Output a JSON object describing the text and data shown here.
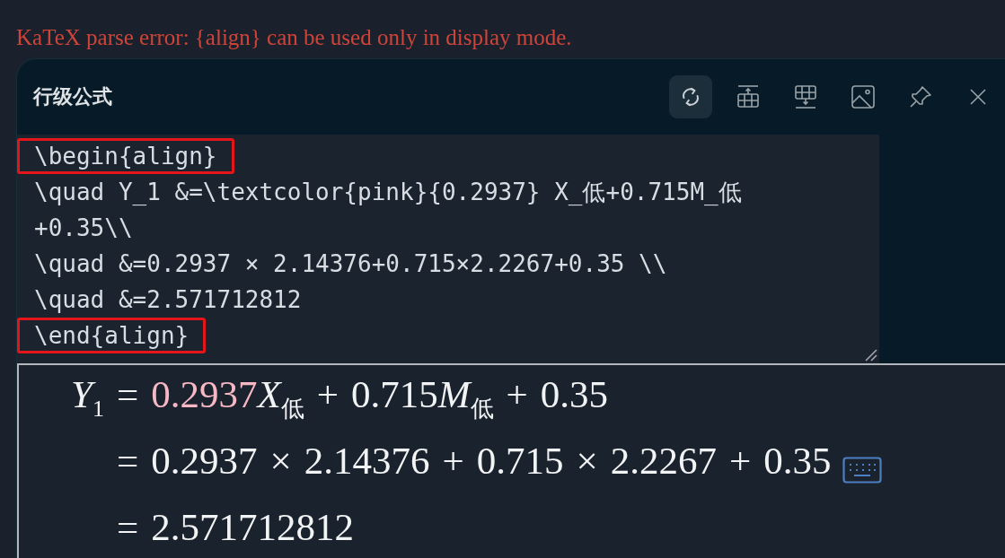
{
  "error_message": "KaTeX parse error: {align} can be used only in display mode.",
  "panel": {
    "title": "行级公式",
    "toolbar": [
      {
        "kind": "refresh",
        "selected": true
      },
      {
        "kind": "insert-above",
        "selected": false
      },
      {
        "kind": "insert-below",
        "selected": false
      },
      {
        "kind": "image",
        "selected": false
      },
      {
        "kind": "pin",
        "selected": false
      },
      {
        "kind": "close",
        "selected": false
      }
    ]
  },
  "editor": {
    "lines": [
      {
        "text": "\\begin{align}",
        "highlighted": true
      },
      {
        "text": "\\quad Y_1 &=\\textcolor{pink}{0.2937} X_低+0.715M_低",
        "highlighted": false
      },
      {
        "text": "+0.35\\\\",
        "highlighted": false
      },
      {
        "text": "\\quad &=0.2937 × 2.14376+0.715×2.2267+0.35 \\\\",
        "highlighted": false
      },
      {
        "text": "\\quad &=2.571712812",
        "highlighted": false
      },
      {
        "text": "\\end{align}",
        "highlighted": true
      }
    ]
  },
  "preview": {
    "rows": [
      {
        "left": [
          {
            "text": "Y",
            "kind": "italic",
            "sub": "1"
          }
        ],
        "right": [
          {
            "text": "=",
            "kind": "operator"
          },
          {
            "text": "0.2937",
            "kind": "pink"
          },
          {
            "text": "X",
            "kind": "italic",
            "sub": "低"
          },
          {
            "text": "+",
            "kind": "operator"
          },
          {
            "text": "0.715",
            "kind": "upright"
          },
          {
            "text": "M",
            "kind": "italic",
            "sub": "低"
          },
          {
            "text": "+",
            "kind": "operator"
          },
          {
            "text": "0.35",
            "kind": "upright"
          }
        ],
        "keyboard": false
      },
      {
        "left": [],
        "right": [
          {
            "text": "=",
            "kind": "operator"
          },
          {
            "text": "0.2937",
            "kind": "upright"
          },
          {
            "text": "×",
            "kind": "operator"
          },
          {
            "text": "2.14376",
            "kind": "upright"
          },
          {
            "text": "+",
            "kind": "operator"
          },
          {
            "text": "0.715",
            "kind": "upright"
          },
          {
            "text": "×",
            "kind": "operator"
          },
          {
            "text": "2.2267",
            "kind": "upright"
          },
          {
            "text": "+",
            "kind": "operator"
          },
          {
            "text": "0.35",
            "kind": "upright"
          }
        ],
        "keyboard": true
      },
      {
        "left": [],
        "right": [
          {
            "text": "=",
            "kind": "operator"
          },
          {
            "text": "2.571712812",
            "kind": "upright"
          }
        ],
        "keyboard": false
      }
    ]
  }
}
